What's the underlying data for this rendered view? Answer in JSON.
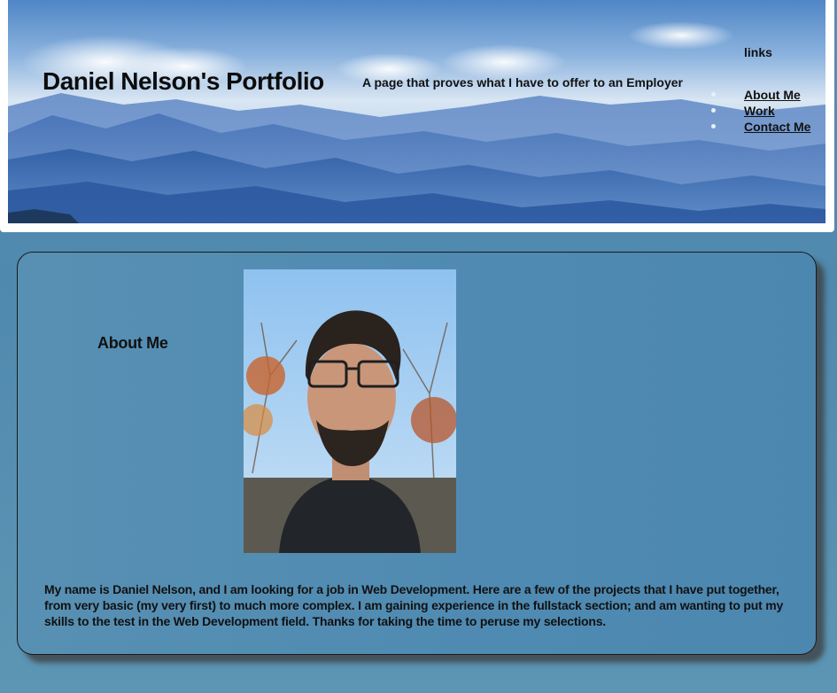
{
  "header": {
    "title": "Daniel Nelson's Portfolio",
    "tagline": "A page that proves what I have to offer to an Employer",
    "links_heading": "links",
    "nav": [
      {
        "label": "About Me"
      },
      {
        "label": "Work"
      },
      {
        "label": "Contact Me"
      }
    ]
  },
  "about": {
    "heading": "About Me",
    "text": "My name is Daniel Nelson, and I am looking for a job in Web Development. Here are a few of the projects that I have put together, from very basic (my very first) to much more complex. I am gaining experience in the fullstack section; and am wanting to put my skills to the test in the Web Development field. Thanks for taking the time to peruse my selections."
  },
  "colors": {
    "page_background": "#4f89ae",
    "hero_sky": "#5a8ec9",
    "mountains": "#3f6fb0",
    "link_bullet": "#e8f0f8"
  }
}
